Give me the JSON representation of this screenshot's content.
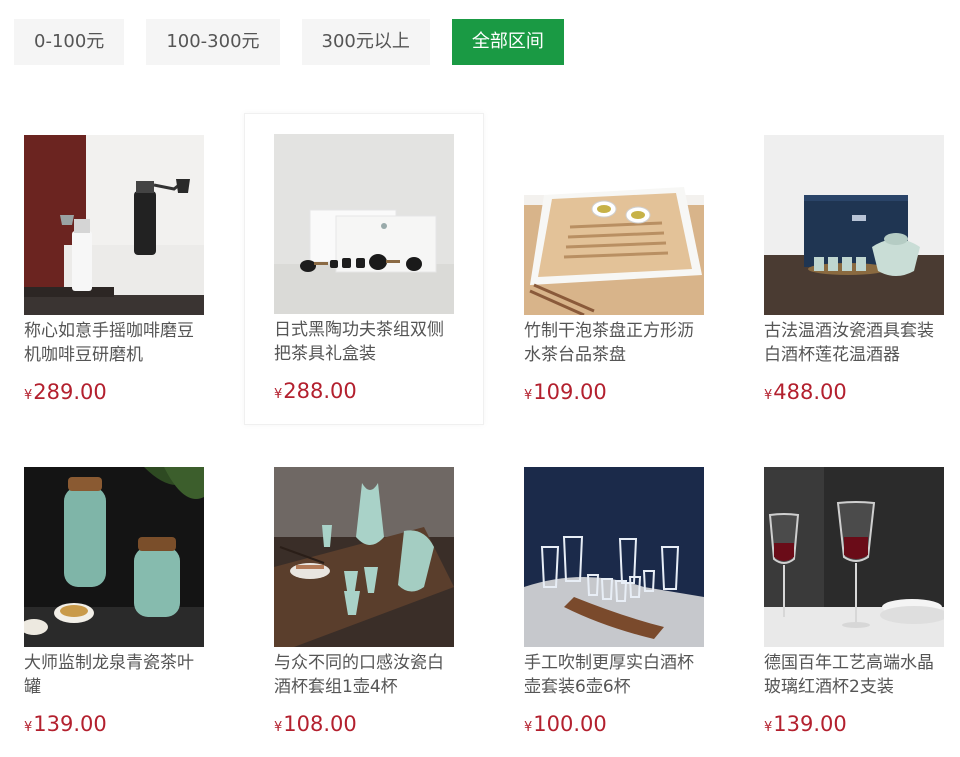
{
  "filters": [
    {
      "label": "0-100元",
      "active": false
    },
    {
      "label": "100-300元",
      "active": false
    },
    {
      "label": "300元以上",
      "active": false
    },
    {
      "label": "全部区间",
      "active": true
    }
  ],
  "currency_symbol": "¥",
  "products": [
    {
      "name": "称心如意手摇咖啡磨豆机咖啡豆研磨机",
      "price": "289.00",
      "image": "coffee-grinder-photo"
    },
    {
      "name": "日式黑陶功夫茶组双侧把茶具礼盒装",
      "price": "288.00",
      "image": "black-tea-set-photo"
    },
    {
      "name": "竹制干泡茶盘正方形沥水茶台品茶盘",
      "price": "109.00",
      "image": "bamboo-tea-tray-photo"
    },
    {
      "name": "古法温酒汝瓷酒具套装白酒杯莲花温酒器",
      "price": "488.00",
      "image": "celadon-wine-set-photo"
    },
    {
      "name": "大师监制龙泉青瓷茶叶罐",
      "price": "139.00",
      "image": "celadon-tea-caddy-photo"
    },
    {
      "name": "与众不同的口感汝瓷白酒杯套组1壶4杯",
      "price": "108.00",
      "image": "celadon-liquor-set-photo"
    },
    {
      "name": "手工吹制更厚实白酒杯壶套装6壶6杯",
      "price": "100.00",
      "image": "glass-liquor-set-photo"
    },
    {
      "name": "德国百年工艺高端水晶玻璃红酒杯2支装",
      "price": "139.00",
      "image": "red-wine-glasses-photo"
    }
  ],
  "colors": {
    "accent_green": "#1a9a44",
    "price_red": "#b3202e",
    "filter_bg": "#f5f5f5"
  }
}
